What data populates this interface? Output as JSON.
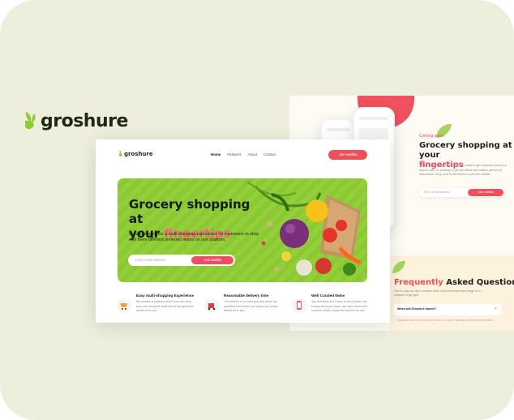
{
  "brand": {
    "name": "groshure"
  },
  "colors": {
    "accent": "#ef4e5b",
    "green": "#8fcc33",
    "frame": "#eeeedd"
  },
  "nav": {
    "logo": "groshure",
    "items": [
      "Home",
      "Features",
      "About",
      "Contact"
    ],
    "cta": "Join waitlist"
  },
  "hero": {
    "title_line1": "Grocery shopping at",
    "title_your": "your ",
    "title_accent": "fingertips",
    "description": "Groshure provides a multi-shopping experience for customers to shop with there different preferred stores on one platform.",
    "email_placeholder": "Enter email address",
    "button": "Join waitlist"
  },
  "features": [
    {
      "title": "Easy multi-shopping Experience",
      "text": "We provide a platform where you can shop from your favourite local stores and get them delivered to you.",
      "icon": "cart-icon"
    },
    {
      "title": "Reasonable delivery time",
      "text": "Our delivery is on time and well within the specified time frame you want your orders delivered to you.",
      "icon": "delivery-icon"
    },
    {
      "title": "Well Curated Items",
      "text": "You definitely don't have to worry about not finding items you need, we have stores and curated unique shops and options for you.",
      "icon": "phone-icon"
    }
  ],
  "coming": {
    "label": "Coming soon!",
    "title_line1": "Grocery shopping at your",
    "title_accent": "fingertips",
    "text": "We're launching very soon! If you want to get informed about our launch date or wanting to get the latest information about our milestones, drop your email below to join the waitlist.",
    "email_placeholder": "Enter email address",
    "button": "Join waitlist"
  },
  "faq": {
    "title_accent": "Frequently",
    "title_rest": " Asked Questions",
    "subtitle": "This is a big one and I consider it one of the most important things for a designer to get right.",
    "question": "When will Groshure launch?",
    "answer": "Groshure orders currently come within 2-7 days of ordering, unless otherwise noted."
  }
}
